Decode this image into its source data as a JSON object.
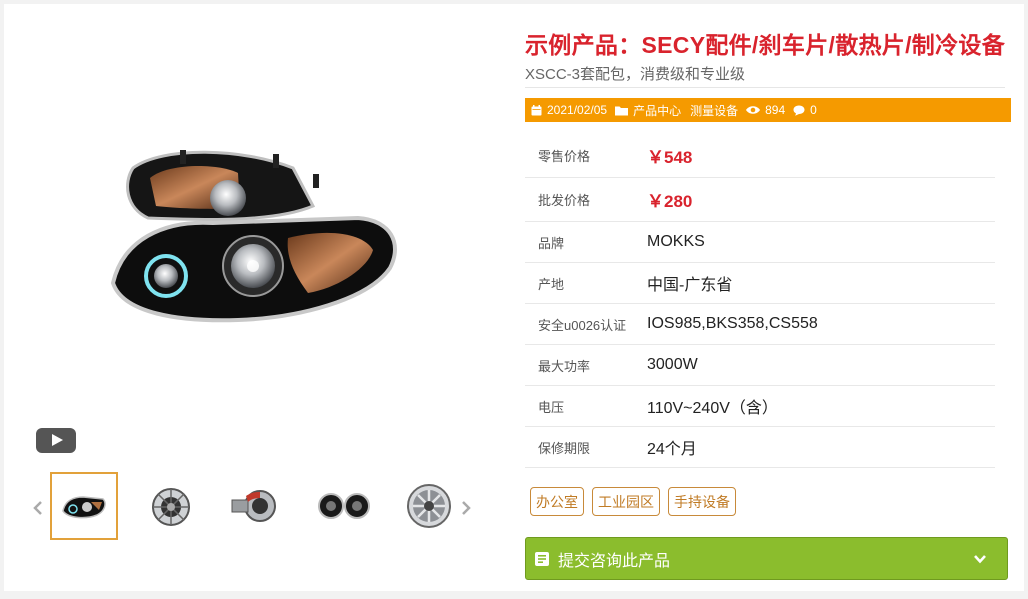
{
  "product": {
    "title": "示例产品：SECY配件/刹车片/散热片/制冷设备",
    "subtitle": "XSCC-3套配包，消费级和专业级"
  },
  "meta": {
    "date": "2021/02/05",
    "categories": [
      "产品中心",
      "测量设备"
    ],
    "views": "894",
    "comments": "0",
    "icons": [
      "calendar-icon",
      "folder-icon",
      "eye-icon",
      "comment-icon"
    ]
  },
  "specs": [
    {
      "label": "零售价格",
      "value": "￥548"
    },
    {
      "label": "批发价格",
      "value": "￥280"
    },
    {
      "label": "品牌",
      "value": "MOKKS"
    },
    {
      "label": "产地",
      "value": "中国-广东省"
    },
    {
      "label": "安全u0026认证",
      "value": "IOS985,BKS358,CS558"
    },
    {
      "label": "最大功率",
      "value": "3000W"
    },
    {
      "label": "电压",
      "value": "110V~240V（含）"
    },
    {
      "label": "保修期限",
      "value": "24个月"
    }
  ],
  "tags": [
    "办公室",
    "工业园区",
    "手持设备"
  ],
  "inquiry": {
    "label": "提交咨询此产品"
  },
  "gallery": {
    "thumbnails": [
      "headlight",
      "alternator",
      "turbocharger",
      "speakers",
      "wheel-rim"
    ],
    "active_index": 0
  },
  "colors": {
    "title_red": "#d9232d",
    "meta_orange": "#f59a00",
    "tag_brown": "#c07b25",
    "inquiry_green": "#8bbd2d"
  }
}
